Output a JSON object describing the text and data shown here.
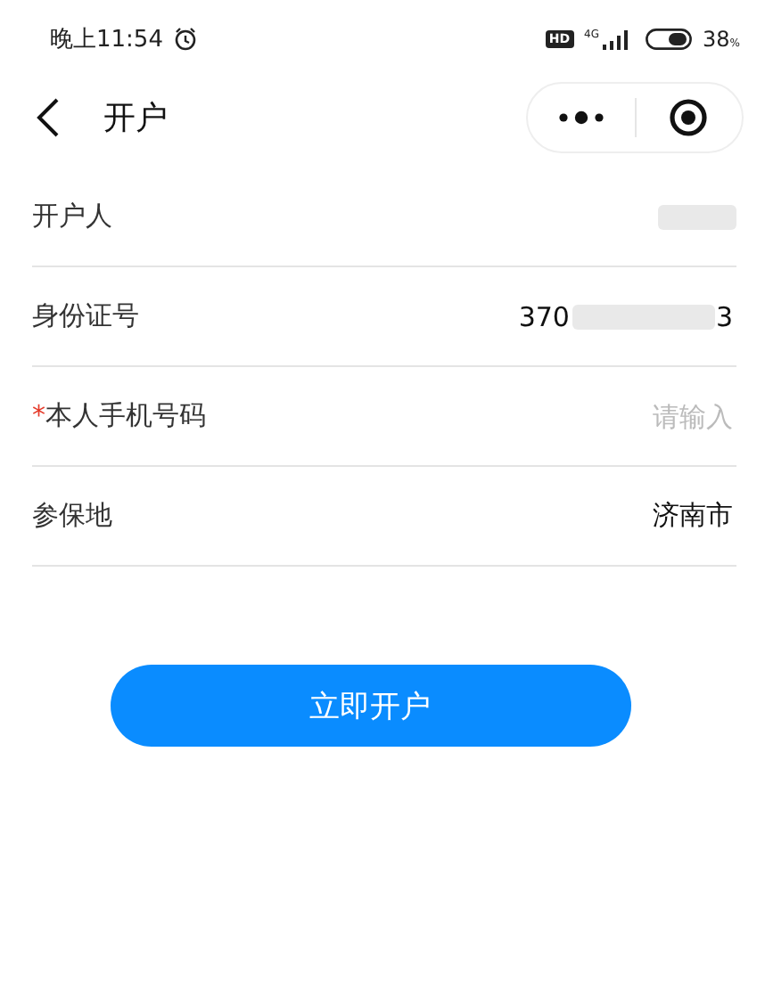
{
  "status_bar": {
    "time": "晚上11:54",
    "hd": "HD",
    "network": "4G",
    "battery": "38",
    "battery_unit": "%"
  },
  "nav": {
    "title": "开户"
  },
  "form": [
    {
      "kind": "text",
      "label": "开户人"
    },
    {
      "kind": "masked",
      "label": "身份证号",
      "value_parts": [
        "370",
        "3"
      ]
    },
    {
      "kind": "input",
      "label": "本人手机号码",
      "required_mark": "*",
      "placeholder": "请输入"
    },
    {
      "kind": "text",
      "label": "参保地",
      "value": "济南市"
    }
  ],
  "submit": {
    "label": "立即开户"
  }
}
